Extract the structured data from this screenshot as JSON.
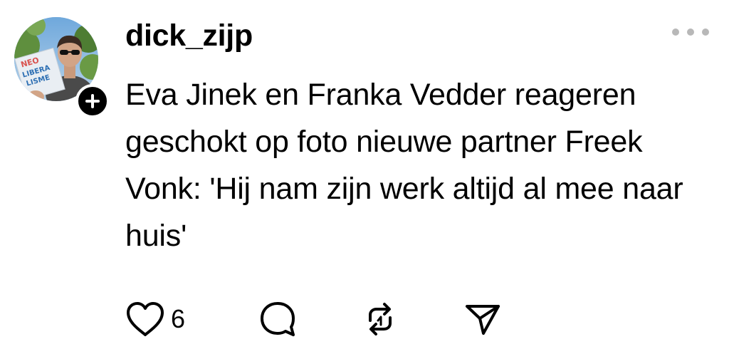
{
  "post": {
    "username": "dick_zijp",
    "text": "Eva Jinek en Franka Vedder reageren geschokt op foto nieuwe partner Freek Vonk: 'Hij nam zijn werk altijd al mee naar huis'",
    "avatar": {
      "book_title": "NEO LIBERA LISME"
    },
    "actions": {
      "like_count": "6"
    }
  },
  "icons": {
    "follow": "plus-icon",
    "more": "more-horizontal-icon",
    "like": "heart-icon",
    "reply": "comment-bubble-icon",
    "repost": "repost-icon",
    "share": "send-icon"
  },
  "colors": {
    "text": "#000000",
    "more_dots": "#b8b8b8",
    "badge": "#000000"
  }
}
